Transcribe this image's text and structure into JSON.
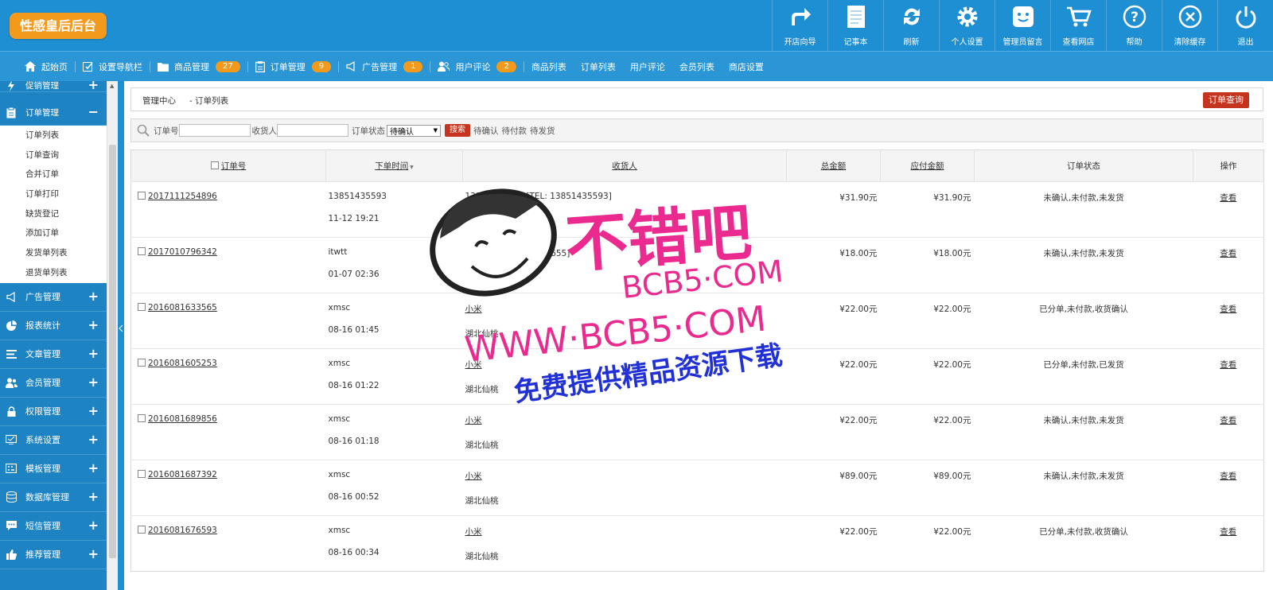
{
  "app": {
    "logo": "性感皇后后台"
  },
  "toolbar": [
    {
      "label": "开店向导",
      "icon": "arrow-icon"
    },
    {
      "label": "记事本",
      "icon": "notebook-icon"
    },
    {
      "label": "刷新",
      "icon": "refresh-icon"
    },
    {
      "label": "个人设置",
      "icon": "gear-icon"
    },
    {
      "label": "管理员留言",
      "icon": "message-icon"
    },
    {
      "label": "查看网店",
      "icon": "cart-icon"
    },
    {
      "label": "帮助",
      "icon": "help-icon"
    },
    {
      "label": "清除缓存",
      "icon": "clear-icon"
    },
    {
      "label": "退出",
      "icon": "power-icon"
    }
  ],
  "nav": {
    "home": "起始页",
    "guide": "设置导航栏",
    "goods": "商品管理",
    "goods_count": "27",
    "orders": "订单管理",
    "orders_count": "9",
    "ads": "广告管理",
    "ads_count": "1",
    "reviews": "用户评论",
    "reviews_count": "2",
    "links": [
      "商品列表",
      "订单列表",
      "用户评论",
      "会员列表",
      "商店设置"
    ]
  },
  "sidebar": {
    "promo": "促销管理",
    "orders": "订单管理",
    "order_items": [
      "订单列表",
      "订单查询",
      "合并订单",
      "订单打印",
      "缺货登记",
      "添加订单",
      "发货单列表",
      "退货单列表"
    ],
    "groups": [
      "广告管理",
      "报表统计",
      "文章管理",
      "会员管理",
      "权限管理",
      "系统设置",
      "模板管理",
      "数据库管理",
      "短信管理",
      "推荐管理"
    ]
  },
  "breadcrumb": {
    "root": "管理中心",
    "current": "- 订单列表",
    "action": "订单查询"
  },
  "search": {
    "order_no_label": "订单号",
    "consignee_label": "收货人",
    "status_label": "订单状态",
    "status_value": "待确认",
    "button": "搜索",
    "quick1": "待确认",
    "quick2": "待付款",
    "quick3": "待发货"
  },
  "table": {
    "headers": {
      "order_no": "订单号",
      "time": "下单时间",
      "consignee": "收货人",
      "total": "总金额",
      "payable": "应付金额",
      "status": "订单状态",
      "op": "操作"
    },
    "rows": [
      {
        "order_no": "2017111254896",
        "buyer": "13851435593",
        "time": "11-12 19:21",
        "consignee": "13851435593",
        "tel": "[TEL: 13851435593]",
        "address": "1385143",
        "total": "¥31.90元",
        "payable": "¥31.90元",
        "status": "未确认,未付款,未发货",
        "op": "查看"
      },
      {
        "order_no": "2017010796342",
        "buyer": "itwtt",
        "time": "01-07 02:36",
        "consignee": "慕瑶",
        "tel": "[TEL: 15677111655]",
        "address": "北京丰台区",
        "total": "¥18.00元",
        "payable": "¥18.00元",
        "status": "未确认,未付款,未发货",
        "op": "查看"
      },
      {
        "order_no": "2016081633565",
        "buyer": "xmsc",
        "time": "08-16 01:45",
        "consignee": "小米",
        "tel": "",
        "address": "湖北仙桃",
        "total": "¥22.00元",
        "payable": "¥22.00元",
        "status": "已分单,未付款,收货确认",
        "op": "查看"
      },
      {
        "order_no": "2016081605253",
        "buyer": "xmsc",
        "time": "08-16 01:22",
        "consignee": "小米",
        "tel": "",
        "address": "湖北仙桃",
        "total": "¥22.00元",
        "payable": "¥22.00元",
        "status": "已分单,未付款,已发货",
        "op": "查看"
      },
      {
        "order_no": "2016081689856",
        "buyer": "xmsc",
        "time": "08-16 01:18",
        "consignee": "小米",
        "tel": "",
        "address": "湖北仙桃",
        "total": "¥22.00元",
        "payable": "¥22.00元",
        "status": "未确认,未付款,未发货",
        "op": "查看"
      },
      {
        "order_no": "2016081687392",
        "buyer": "xmsc",
        "time": "08-16 00:52",
        "consignee": "小米",
        "tel": "",
        "address": "湖北仙桃",
        "total": "¥89.00元",
        "payable": "¥89.00元",
        "status": "未确认,未付款,未发货",
        "op": "查看"
      },
      {
        "order_no": "2016081676593",
        "buyer": "xmsc",
        "time": "08-16 00:34",
        "consignee": "小米",
        "tel": "",
        "address": "湖北仙桃",
        "total": "¥22.00元",
        "payable": "¥22.00元",
        "status": "已分单,未付款,收货确认",
        "op": "查看"
      }
    ]
  },
  "watermark": {
    "line1": "不错吧",
    "line2": "BCB5·COM",
    "line3": "WWW·BCB5·COM",
    "line4": "免费提供精品资源下载"
  },
  "colors": {
    "primary": "#1e8fd2",
    "accent": "#f39a1d",
    "danger": "#c4341e"
  }
}
